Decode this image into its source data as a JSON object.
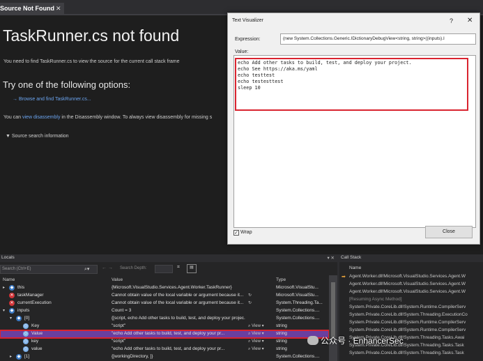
{
  "source_tab": {
    "label": "Source Not Found",
    "pin": "⇔",
    "close": "✕"
  },
  "doc": {
    "title": "TaskRunner.cs not found",
    "desc": "You need to find TaskRunner.cs to view the source for the current call stack frame",
    "options_title": "Try one of the following options:",
    "browse_link": "→ Browse and find TaskRunner.cs...",
    "disasm_prefix": "You can ",
    "disasm_link": "view disassembly",
    "disasm_suffix": " in the Disassembly window. To always view disassembly for missing s",
    "source_search": "▼ Source search information"
  },
  "dialog": {
    "title": "Text Visualizer",
    "help": "?",
    "close": "✕",
    "expression_label": "Expression:",
    "expression_value": "(new System.Collections.Generic.IDictionaryDebugView<string, string>((inputs).I",
    "value_label": "Value:",
    "value_text": "echo Add other tasks to build, test, and deploy your project.\necho See https://aka.ms/yaml\necho testtest\necho testesttest\nsleep 10",
    "wrap_label": "Wrap",
    "wrap_checked": "✓",
    "close_button": "Close"
  },
  "locals": {
    "title": "Locals",
    "controls": "▾ ✕",
    "search_placeholder": "Search (Ctrl+E)",
    "search_icon": "⌕▾",
    "nav_arrows": "←  →",
    "search_depth_label": "Search Depth:",
    "toolbar_icon1": "⌗",
    "toolbar_icon2": "▤",
    "columns": {
      "name": "Name",
      "value": "Value",
      "type": "Type"
    },
    "rows": [
      {
        "twisty": "▸",
        "icon": "◆",
        "name": "this",
        "value": "{Microsoft.VisualStudio.Services.Agent.Worker.TaskRunner}",
        "view": "",
        "type": "Microsoft.VisualStu..."
      },
      {
        "twisty": "",
        "icon": "✕",
        "name": "taskManager",
        "value": "Cannot obtain value of the local variable or argument because it...",
        "view": "↻",
        "type": "Microsoft.VisualStu..."
      },
      {
        "twisty": "",
        "icon": "✕",
        "name": "currentExecution",
        "value": "Cannot obtain value of the local variable or argument because it...",
        "view": "↻",
        "type": "System.Threading.Ta..."
      },
      {
        "twisty": "▾",
        "icon": "◆",
        "name": "inputs",
        "value": "Count = 3",
        "view": "",
        "type": "System.Collections...."
      },
      {
        "twisty": "▾",
        "icon": "◆",
        "name": "[0]",
        "value": "{[script, echo Add other tasks to build, test, and deploy your projec...",
        "view": "",
        "type": "System.Collections...."
      },
      {
        "twisty": "",
        "icon": "◇",
        "name": "Key",
        "value": "\"script\"",
        "view": "⌕ View ▾",
        "type": "string"
      },
      {
        "twisty": "",
        "icon": "◇",
        "name": "Value",
        "value": "\"echo Add other tasks to build, test, and deploy your pr...",
        "view": "⌕ View ▾",
        "type": "string"
      },
      {
        "twisty": "",
        "icon": "◇",
        "name": "key",
        "value": "\"script\"",
        "view": "⌕ View ▾",
        "type": "string"
      },
      {
        "twisty": "",
        "icon": "◇",
        "name": "value",
        "value": "\"echo Add other tasks to build, test, and deploy your pr...",
        "view": "⌕ View ▾",
        "type": "string"
      },
      {
        "twisty": "▸",
        "icon": "◆",
        "name": "[1]",
        "value": "{[workingDirectory, ]}",
        "view": "",
        "type": "System.Collections...."
      }
    ]
  },
  "callstack": {
    "title": "Call Stack",
    "column_name": "Name",
    "rows": [
      {
        "arrow": "➡",
        "text": "Agent.Worker.dll!Microsoft.VisualStudio.Services.Agent.W",
        "dim": false
      },
      {
        "arrow": "",
        "text": "Agent.Worker.dll!Microsoft.VisualStudio.Services.Agent.W",
        "dim": false
      },
      {
        "arrow": "",
        "text": "Agent.Worker.dll!Microsoft.VisualStudio.Services.Agent.W",
        "dim": false
      },
      {
        "arrow": "",
        "text": "[Resuming Async Method]",
        "dim": true
      },
      {
        "arrow": "",
        "text": "System.Private.CoreLib.dll!System.Runtime.CompilerServ",
        "dim": false
      },
      {
        "arrow": "",
        "text": "System.Private.CoreLib.dll!System.Threading.ExecutionCo",
        "dim": false
      },
      {
        "arrow": "",
        "text": "System.Private.CoreLib.dll!System.Runtime.CompilerServ",
        "dim": false
      },
      {
        "arrow": "",
        "text": "System.Private.CoreLib.dll!System.Runtime.CompilerServ",
        "dim": false
      },
      {
        "arrow": "",
        "text": "System.Private.CoreLib.dll!System.Threading.Tasks.Awai",
        "dim": false
      },
      {
        "arrow": "",
        "text": "System.Private.CoreLib.dll!System.Threading.Tasks.Task",
        "dim": false
      },
      {
        "arrow": "",
        "text": "System.Private.CoreLib.dll!System.Threading.Tasks.Task",
        "dim": false
      }
    ]
  },
  "watermark": {
    "text": "公众号 · EnhancerSec"
  },
  "colors": {
    "highlight": "#d9232f",
    "selection": "#6a3fa0",
    "link": "#6ba4ef",
    "error_icon": "#d13438",
    "object_icon": "#3a78c2",
    "field_icon": "#7fb1e8"
  }
}
